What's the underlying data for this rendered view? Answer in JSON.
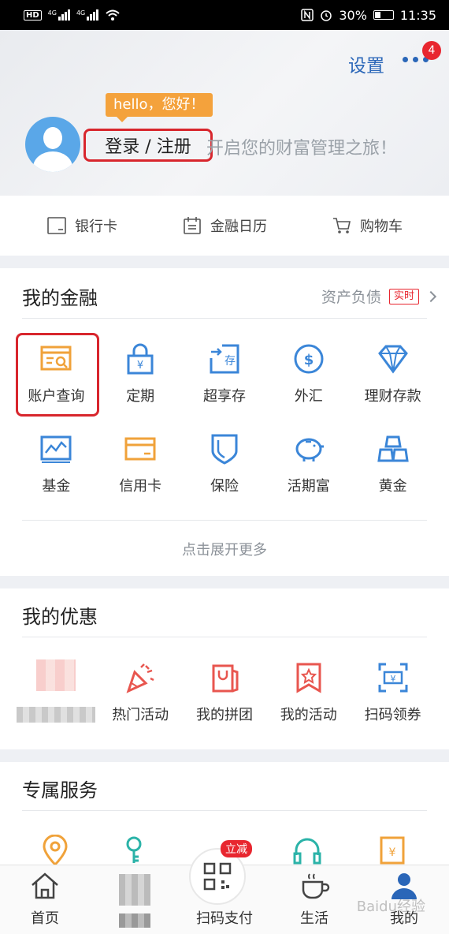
{
  "status_bar": {
    "hd": "HD",
    "net1": "4G",
    "net2": "4G",
    "battery": "30%",
    "time": "11:35"
  },
  "header": {
    "settings": "设置",
    "badge": "4",
    "hello": "hello，您好！",
    "login": "登录 / 注册",
    "slogan": "开启您的财富管理之旅！"
  },
  "quick": [
    {
      "label": "银行卡",
      "icon": "bank-card-icon"
    },
    {
      "label": "金融日历",
      "icon": "calendar-icon"
    },
    {
      "label": "购物车",
      "icon": "cart-icon"
    }
  ],
  "finance": {
    "title": "我的金融",
    "assets": "资产负债",
    "realtime": "实时",
    "items": [
      {
        "label": "账户查询",
        "icon": "account-query-icon",
        "color": "#f0a23a"
      },
      {
        "label": "定期",
        "icon": "lock-icon",
        "color": "#3b86d8"
      },
      {
        "label": "超享存",
        "icon": "deposit-icon",
        "color": "#3b86d8"
      },
      {
        "label": "外汇",
        "icon": "dollar-icon",
        "color": "#3b86d8"
      },
      {
        "label": "理财存款",
        "icon": "diamond-icon",
        "color": "#3b86d8"
      },
      {
        "label": "基金",
        "icon": "fund-chart-icon",
        "color": "#3b86d8"
      },
      {
        "label": "信用卡",
        "icon": "credit-card-icon",
        "color": "#f0a23a"
      },
      {
        "label": "保险",
        "icon": "shield-icon",
        "color": "#3b86d8"
      },
      {
        "label": "活期富",
        "icon": "piggy-bank-icon",
        "color": "#3b86d8"
      },
      {
        "label": "黄金",
        "icon": "gold-bars-icon",
        "color": "#3b86d8"
      }
    ],
    "expand": "点击展开更多"
  },
  "offers": {
    "title": "我的优惠",
    "items": [
      {
        "label": "热门活动",
        "icon": "party-popper-icon"
      },
      {
        "label": "我的拼团",
        "icon": "shopping-bag-icon"
      },
      {
        "label": "我的活动",
        "icon": "star-flag-icon"
      },
      {
        "label": "扫码领券",
        "icon": "scan-coupon-icon"
      }
    ]
  },
  "services": {
    "title": "专属服务"
  },
  "bottom_nav": {
    "home": "首页",
    "scan": "扫码支付",
    "scan_badge": "立减",
    "life": "生活",
    "mine": "我的"
  },
  "watermark": "Baidu经验",
  "colors": {
    "primary": "#2a66b8",
    "accent": "#f0a23a",
    "highlight": "#d8262d",
    "offer": "#e8564f"
  }
}
